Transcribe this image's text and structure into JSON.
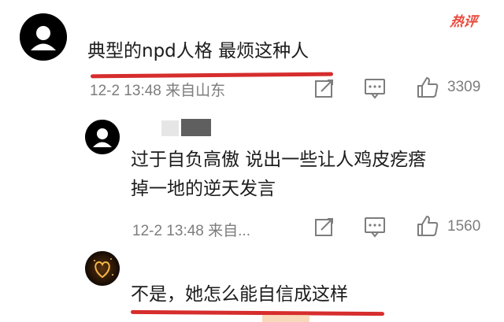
{
  "top_badge": "热评",
  "comments": [
    {
      "text": "典型的npd人格 最烦这种人",
      "meta": "12-2 13:48 来自山东",
      "likes": "3309"
    },
    {
      "text_line1": "过于自负高傲 说出一些让人鸡皮疙瘩",
      "text_line2": "掉一地的逆天发言",
      "meta": "12-2 13:48 来自...",
      "likes": "1560"
    },
    {
      "text": "不是，她怎么能自信成这样"
    }
  ],
  "colors": {
    "underline": "#d62d2d",
    "badge": "#e8483b",
    "meta": "#7d7d7d"
  }
}
